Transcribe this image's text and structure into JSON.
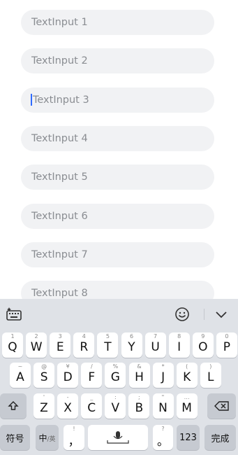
{
  "inputs": [
    {
      "placeholder": "TextInput 1",
      "focused": false
    },
    {
      "placeholder": "TextInput 2",
      "focused": false
    },
    {
      "placeholder": "TextInput 3",
      "focused": true
    },
    {
      "placeholder": "TextInput 4",
      "focused": false
    },
    {
      "placeholder": "TextInput 5",
      "focused": false
    },
    {
      "placeholder": "TextInput 6",
      "focused": false
    },
    {
      "placeholder": "TextInput 7",
      "focused": false
    },
    {
      "placeholder": "TextInput 8",
      "focused": false
    }
  ],
  "keyboard": {
    "row1": [
      {
        "key": "Q",
        "hint": "1"
      },
      {
        "key": "W",
        "hint": "2"
      },
      {
        "key": "E",
        "hint": "3"
      },
      {
        "key": "R",
        "hint": "4"
      },
      {
        "key": "T",
        "hint": "5"
      },
      {
        "key": "Y",
        "hint": "6"
      },
      {
        "key": "U",
        "hint": "7"
      },
      {
        "key": "I",
        "hint": "8"
      },
      {
        "key": "O",
        "hint": "9"
      },
      {
        "key": "P",
        "hint": "0"
      }
    ],
    "row2": [
      {
        "key": "A",
        "hint": "~"
      },
      {
        "key": "S",
        "hint": "@"
      },
      {
        "key": "D",
        "hint": "¥"
      },
      {
        "key": "F",
        "hint": "/"
      },
      {
        "key": "G",
        "hint": "%"
      },
      {
        "key": "H",
        "hint": "&"
      },
      {
        "key": "J",
        "hint": "*"
      },
      {
        "key": "K",
        "hint": "("
      },
      {
        "key": "L",
        "hint": ")"
      }
    ],
    "row3": [
      {
        "key": "Z",
        "hint": "'"
      },
      {
        "key": "X",
        "hint": "-"
      },
      {
        "key": "C",
        "hint": "_"
      },
      {
        "key": "V",
        "hint": ":"
      },
      {
        "key": "B",
        "hint": ";"
      },
      {
        "key": "N",
        "hint": "\""
      },
      {
        "key": "M",
        "hint": "…"
      }
    ],
    "symbols_label": "符号",
    "lang_label_main": "中",
    "lang_label_sub": "/英",
    "comma_label": "，",
    "comma_hint": "!",
    "period_label": "。",
    "period_hint": "?",
    "num_label": "123",
    "done_label": "完成"
  },
  "colors": {
    "accent": "#2f6bff",
    "input_bg": "#f1f2f4",
    "keyboard_bg": "#dfe2e7"
  }
}
